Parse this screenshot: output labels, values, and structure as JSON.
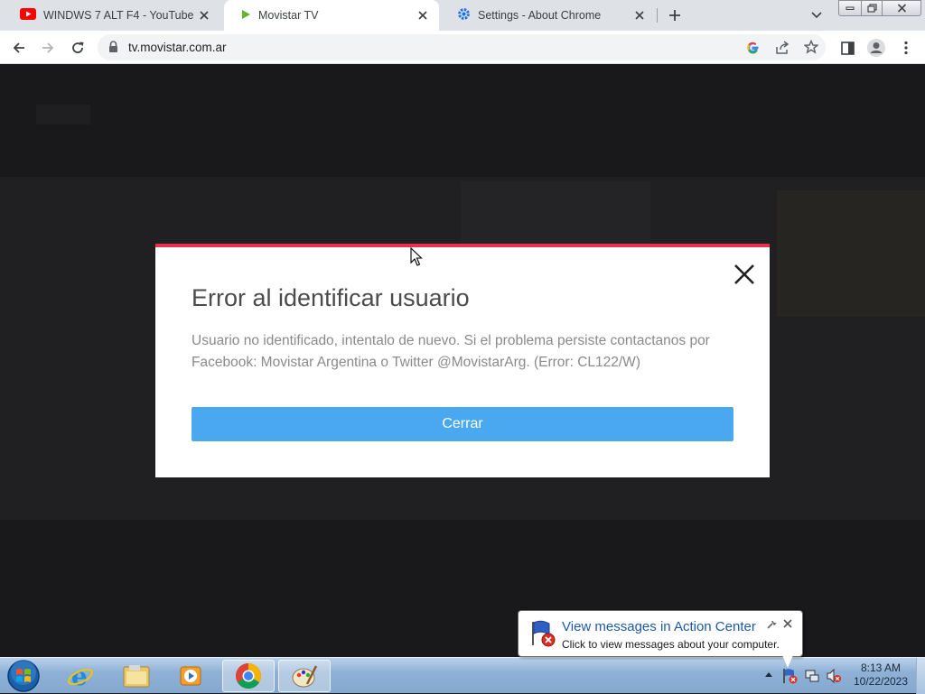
{
  "browser": {
    "tabs": [
      {
        "label": "WINDWS 7 ALT F4 - YouTube",
        "icon": "youtube-icon",
        "active": false
      },
      {
        "label": "Movistar TV",
        "icon": "play-icon",
        "active": true
      },
      {
        "label": "Settings - About Chrome",
        "icon": "gear-icon",
        "active": false
      }
    ],
    "url": "tv.movistar.com.ar"
  },
  "dialog": {
    "title": "Error al identificar usuario",
    "message": "Usuario no identificado, intentalo de nuevo. Si el problema persiste contactanos por Facebook: Movistar Argentina o Twitter @MovistarArg. (Error: CL122/W)",
    "button_label": "Cerrar"
  },
  "notification": {
    "title": "View messages in Action Center",
    "text": "Click to view messages about your computer."
  },
  "taskbar": {
    "apps": [
      "internet-explorer",
      "file-explorer",
      "media-player",
      "chrome",
      "paint"
    ],
    "time": "8:13 AM",
    "date": "10/22/2023"
  },
  "colors": {
    "dialog_accent": "#e8304f",
    "button_blue": "#4aa8f0",
    "tab_strip": "#dee1e6",
    "page_bg": "#19191b"
  }
}
